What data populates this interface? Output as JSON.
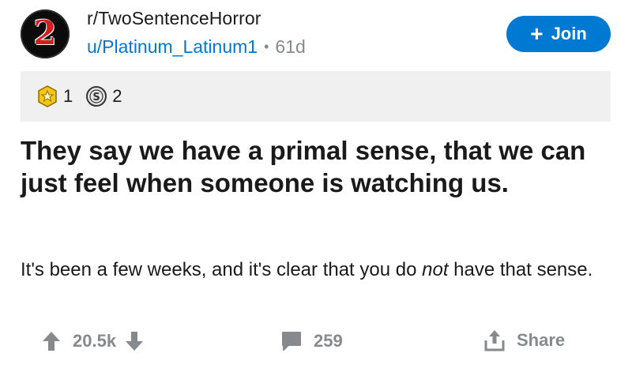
{
  "post": {
    "avatar_text": "2",
    "subreddit": "r/TwoSentenceHorror",
    "author": "u/Platinum_Latinum1",
    "separator": "•",
    "age": "61d",
    "join_label": "Join",
    "awards": [
      {
        "icon": "gold-star-award-icon",
        "count": "1"
      },
      {
        "icon": "silver-award-icon",
        "count": "2"
      }
    ],
    "title": "They say we have a primal sense, that we can just feel when someone is watching us.",
    "body_before": "It's been a few weeks, and it's clear that you do ",
    "body_emphasis": "not",
    "body_after": " have that sense."
  },
  "footer": {
    "score": "20.5k",
    "comments": "259",
    "share_label": "Share"
  },
  "colors": {
    "accent": "#0079d3",
    "muted": "#878a8c",
    "award_bar_bg": "#f0f0f0"
  }
}
